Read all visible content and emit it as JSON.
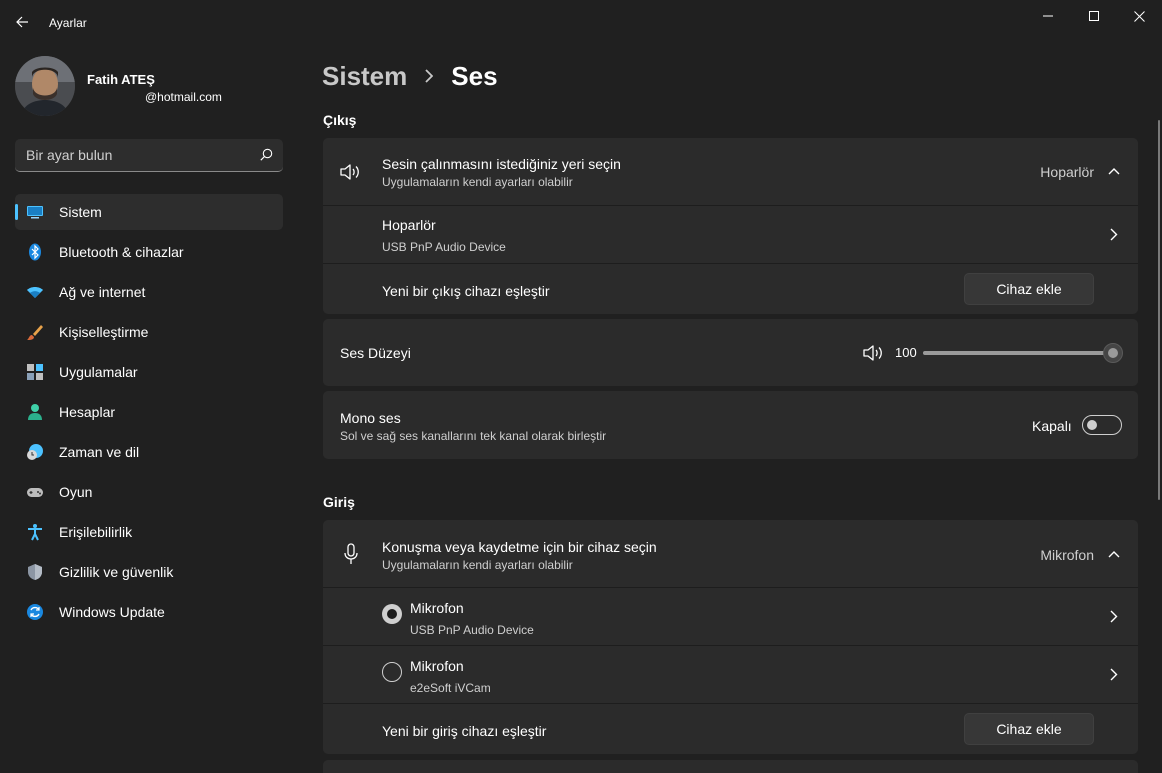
{
  "window": {
    "title": "Ayarlar",
    "controls": [
      "minimize",
      "maximize",
      "close"
    ]
  },
  "user": {
    "name": "Fatih ATEŞ",
    "email": "@hotmail.com"
  },
  "search": {
    "placeholder": "Bir ayar bulun"
  },
  "sidebar": {
    "items": [
      {
        "label": "Sistem",
        "icon": "monitor-icon",
        "active": true
      },
      {
        "label": "Bluetooth & cihazlar",
        "icon": "bluetooth-icon"
      },
      {
        "label": "Ağ ve internet",
        "icon": "wifi-icon"
      },
      {
        "label": "Kişiselleştirme",
        "icon": "brush-icon"
      },
      {
        "label": "Uygulamalar",
        "icon": "apps-icon"
      },
      {
        "label": "Hesaplar",
        "icon": "person-icon"
      },
      {
        "label": "Zaman ve dil",
        "icon": "clock-globe-icon"
      },
      {
        "label": "Oyun",
        "icon": "gamepad-icon"
      },
      {
        "label": "Erişilebilirlik",
        "icon": "accessibility-icon"
      },
      {
        "label": "Gizlilik ve güvenlik",
        "icon": "shield-icon"
      },
      {
        "label": "Windows Update",
        "icon": "update-icon"
      }
    ]
  },
  "breadcrumb": {
    "parent": "Sistem",
    "current": "Ses"
  },
  "output": {
    "section_title": "Çıkış",
    "selector": {
      "title": "Sesin çalınmasını istediğiniz yeri seçin",
      "subtitle": "Uygulamaların kendi ayarları olabilir",
      "value": "Hoparlör"
    },
    "device": {
      "name": "Hoparlör",
      "description": "USB PnP Audio Device"
    },
    "pair": {
      "label": "Yeni bir çıkış cihazı eşleştir",
      "button": "Cihaz ekle"
    },
    "volume": {
      "label": "Ses Düzeyi",
      "value": "100",
      "level": 1.0
    },
    "mono": {
      "title": "Mono ses",
      "subtitle": "Sol ve sağ ses kanallarını tek kanal olarak birleştir",
      "state": "Kapalı",
      "on": false
    }
  },
  "input": {
    "section_title": "Giriş",
    "selector": {
      "title": "Konuşma veya kaydetme için bir cihaz seçin",
      "subtitle": "Uygulamaların kendi ayarları olabilir",
      "value": "Mikrofon"
    },
    "devices": [
      {
        "name": "Mikrofon",
        "description": "USB PnP Audio Device",
        "selected": true
      },
      {
        "name": "Mikrofon",
        "description": "e2eSoft iVCam",
        "selected": false
      }
    ],
    "pair": {
      "label": "Yeni bir giriş cihazı eşleştir",
      "button": "Cihaz ekle"
    }
  },
  "colors": {
    "background": "#202020",
    "card": "#2b2b2b",
    "accent": "#4cc2ff"
  }
}
